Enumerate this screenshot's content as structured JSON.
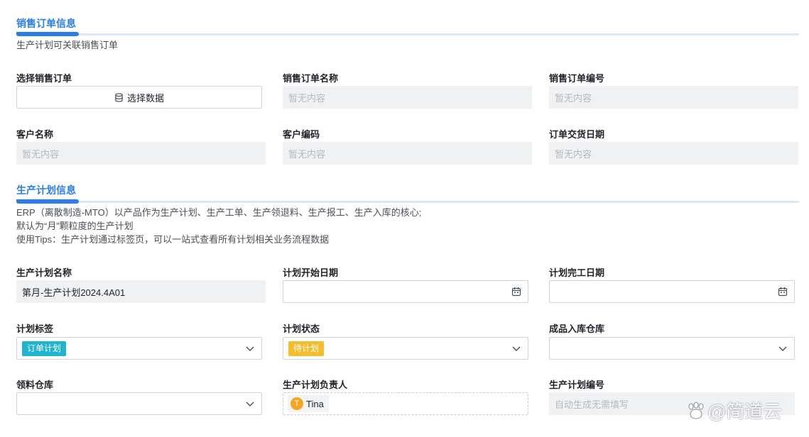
{
  "sales_section": {
    "title": "销售订单信息",
    "description": "生产计划可关联销售订单",
    "fields": {
      "select_order": {
        "label": "选择销售订单",
        "button_label": "选择数据",
        "button_icon": "database-icon"
      },
      "order_name": {
        "label": "销售订单名称",
        "value": "暂无内容"
      },
      "order_number": {
        "label": "销售订单编号",
        "value": "暂无内容"
      },
      "customer_name": {
        "label": "客户名称",
        "value": "暂无内容"
      },
      "customer_code": {
        "label": "客户编码",
        "value": "暂无内容"
      },
      "delivery_date": {
        "label": "订单交货日期",
        "value": "暂无内容"
      }
    }
  },
  "plan_section": {
    "title": "生产计划信息",
    "description_lines": [
      "ERP（离散制造-MTO）以产品作为生产计划、生产工单、生产领退料、生产报工、生产入库的核心;",
      "默认为“月”颗粒度的生产计划",
      "使用Tips：生产计划通过标签页，可以一站式查看所有计划相关业务流程数据"
    ],
    "fields": {
      "plan_name": {
        "label": "生产计划名称",
        "value": "第月-生产计划2024.4A01"
      },
      "start_date": {
        "label": "计划开始日期",
        "value": ""
      },
      "end_date": {
        "label": "计划完工日期",
        "value": ""
      },
      "plan_tag": {
        "label": "计划标签",
        "value": "订单计划",
        "color": "#1fb4cf"
      },
      "plan_status": {
        "label": "计划状态",
        "value": "待计划",
        "color": "#f5bc2b"
      },
      "finished_warehouse": {
        "label": "成品入库仓库",
        "value": ""
      },
      "material_warehouse": {
        "label": "领料仓库",
        "value": ""
      },
      "plan_owner": {
        "label": "生产计划负责人",
        "avatar_initial": "T",
        "name": "Tina"
      },
      "plan_number": {
        "label": "生产计划编号",
        "value": "自动生成无需填写"
      }
    }
  },
  "watermark": {
    "text": "@简道云"
  },
  "colors": {
    "accent": "#2a7dea",
    "tag_cyan": "#1fb4cf",
    "tag_yellow": "#f5bc2b"
  }
}
